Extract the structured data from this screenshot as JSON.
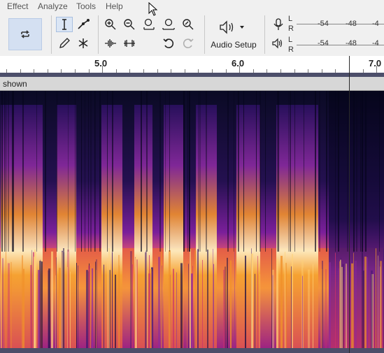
{
  "menu": {
    "items": [
      "Effect",
      "Analyze",
      "Tools",
      "Help"
    ]
  },
  "toolbar": {
    "audio_setup_label": "Audio Setup",
    "meter_channels": [
      "L",
      "R",
      "L",
      "R"
    ],
    "record_meter_ticks": [
      "-54",
      "-48",
      "-4"
    ],
    "play_meter_ticks": [
      "-54",
      "-48",
      "-4"
    ]
  },
  "timeline": {
    "labels": [
      "5.0",
      "6.0",
      "7.0"
    ]
  },
  "track": {
    "name": "shown"
  },
  "colors": {
    "accent": "#d4e0f2",
    "ruler_bar": "#4c4e6a",
    "spectrogram_dark": "#0a0820"
  }
}
